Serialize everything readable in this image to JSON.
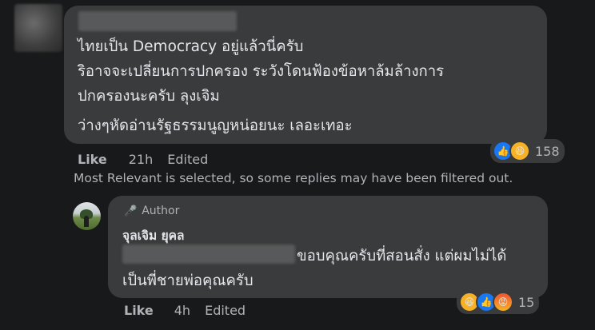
{
  "comment": {
    "lines": [
      "ไทยเป็น Democracy อยู่แล้วนี่ครับ",
      "ริอาจจะเปลี่ยนการปกครอง ระวังโดนฟ้องข้อหาล้มล้างการ",
      "ปกครองนะครับ ลุงเจิม"
    ],
    "line2": "ว่างๆหัดอ่านรัฐธรรมนูญหน่อยนะ เลอะเทอะ",
    "reaction_count": "158",
    "reaction_icons": [
      "like-icon",
      "haha-icon"
    ],
    "like_label": "Like",
    "time": "21h",
    "edited": "Edited"
  },
  "filter_note": "Most Relevant is selected, so some replies may have been filtered out.",
  "reply": {
    "badge": "Author",
    "author": "จุลเจิม ยุคล",
    "text": "ขอบคุณครับที่สอนสั่ง แต่ผมไม่ได้เป็นพี่ชายพ่อคุณครับ",
    "reaction_count": "15",
    "reaction_icons": [
      "haha-icon",
      "like-icon",
      "angry-icon"
    ],
    "like_label": "Like",
    "time": "4h",
    "edited": "Edited"
  },
  "colors": {
    "background": "#18191a",
    "bubble": "#3a3b3c",
    "text": "#e4e6eb",
    "secondary_text": "#b0b3b8",
    "like_blue": "#1877f2"
  }
}
